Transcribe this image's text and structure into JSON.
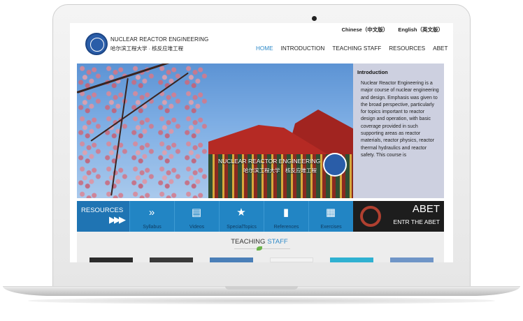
{
  "languages": {
    "chinese": "Chinese（中文版）",
    "english": "English（英文版）"
  },
  "brand": {
    "name_en": "NUCLEAR REACTOR ENGINEERING",
    "name_cn": "哈尔滨工程大学 · 核反应堆工程"
  },
  "nav": [
    {
      "label": "HOME",
      "active": true
    },
    {
      "label": "INTRODUCTION",
      "active": false
    },
    {
      "label": "TEACHING STAFF",
      "active": false
    },
    {
      "label": "RESOURCES",
      "active": false
    },
    {
      "label": "ABET",
      "active": false
    }
  ],
  "hero": {
    "title_en": "NUCLEAR REACTOR ENGINEERING",
    "title_cn": "哈尔滨工程大学　核反应堆工程"
  },
  "intro": {
    "title": "Introduction",
    "body": "Nuclear Reactor Engineering is a major course of nuclear engineering and design. Emphasis was given to the broad perspective, particularly for topics important to reactor design and operation, with basic coverage provided in such supporting areas as reactor materials, reactor physics, reactor thermal hydraulics and reactor safety. This course is"
  },
  "resources": {
    "label": "RESOURCES",
    "items": [
      {
        "label": "Syllabus",
        "icon": "double-chevron-icon"
      },
      {
        "label": "Videos",
        "icon": "film-icon"
      },
      {
        "label": "SpecialTopics",
        "icon": "star-folder-icon"
      },
      {
        "label": "References",
        "icon": "book-icon"
      },
      {
        "label": "Exercises",
        "icon": "document-icon"
      }
    ]
  },
  "abet": {
    "title": "ABET",
    "subtitle": "ENTR THE ABET"
  },
  "staff": {
    "title_part1": "TEACHING",
    "title_part2": "STAFF"
  },
  "colors": {
    "accent": "#2e8ac9",
    "resource_bar": "#2285c4",
    "intro_bg": "#cdd0e0",
    "abet_bg": "#1d1d1d"
  }
}
